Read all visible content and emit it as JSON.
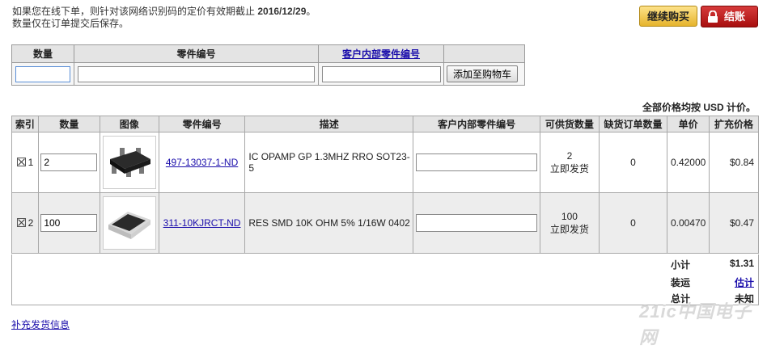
{
  "notice": {
    "line1_prefix": "如果您在线下单，则针对该网络识别码的定价有效期截止 ",
    "line1_date": "2016/12/29",
    "line1_suffix": "。",
    "line2": "数量仅在订单提交后保存。"
  },
  "buttons": {
    "continue": "继续购买",
    "checkout": "结账"
  },
  "add_form": {
    "headers": [
      "数量",
      "零件编号",
      "客户内部零件编号"
    ],
    "add_button": "添加至购物车",
    "qty_value": "",
    "part_value": "",
    "customer_part_value": ""
  },
  "usd_note": "全部价格均按 USD 计价。",
  "cart": {
    "headers": [
      "索引",
      "数量",
      "图像",
      "零件编号",
      "描述",
      "客户内部零件编号",
      "可供货数量",
      "缺货订单数量",
      "单价",
      "扩充价格"
    ],
    "rows": [
      {
        "index": "1",
        "qty": "2",
        "part_no": "497-13037-1-ND",
        "description": "IC OPAMP GP 1.3MHZ RRO SOT23-5",
        "customer_part": "",
        "available_qty": "2",
        "available_status": "立即发货",
        "backorder": "0",
        "unit_price": "0.42000",
        "ext_price": "$0.84"
      },
      {
        "index": "2",
        "qty": "100",
        "part_no": "311-10KJRCT-ND",
        "description": "RES SMD 10K OHM 5% 1/16W 0402",
        "customer_part": "",
        "available_qty": "100",
        "available_status": "立即发货",
        "backorder": "0",
        "unit_price": "0.00470",
        "ext_price": "$0.47"
      }
    ]
  },
  "summary": {
    "subtotal_label": "小计",
    "subtotal_value": "$1.31",
    "shipping_label": "装运",
    "shipping_value": "估计",
    "total_label": "总计",
    "total_value": "未知"
  },
  "shipping_info_link": "补充发货信息",
  "watermark": "21ic中国电子网",
  "colors": {
    "checkout": "#b81414",
    "continue": "#f2c94c",
    "link": "#1a0dab"
  }
}
